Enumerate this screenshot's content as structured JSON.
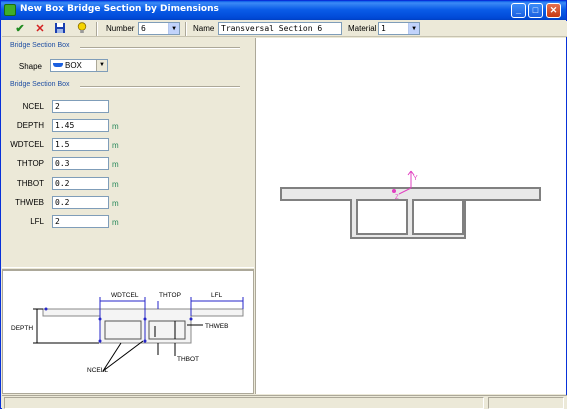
{
  "window": {
    "title": "New  Box Bridge Section by Dimensions"
  },
  "toolbar": {
    "number_label": "Number",
    "number_value": "6",
    "name_label": "Name",
    "name_value": "Transversal Section 6",
    "material_label": "Material",
    "material_value": "1",
    "icons": [
      "check-icon",
      "cancel-icon",
      "save-icon",
      "help-bulb-icon"
    ]
  },
  "panel": {
    "group1_title": "Bridge Section Box",
    "shape_label": "Shape",
    "shape_value": "BOX",
    "group2_title": "Bridge Section Box",
    "fields": [
      {
        "label": "NCEL",
        "value": "2",
        "unit": ""
      },
      {
        "label": "DEPTH",
        "value": "1.45",
        "unit": "m"
      },
      {
        "label": "WDTCEL",
        "value": "1.5",
        "unit": "m"
      },
      {
        "label": "THTOP",
        "value": "0.3",
        "unit": "m"
      },
      {
        "label": "THBOT",
        "value": "0.2",
        "unit": "m"
      },
      {
        "label": "THWEB",
        "value": "0.2",
        "unit": "m"
      },
      {
        "label": "LFL",
        "value": "2",
        "unit": "m"
      }
    ]
  },
  "diagram": {
    "labels": {
      "wdtcel": "WDTCEL",
      "thtop": "THTOP",
      "lfl": "LFL",
      "depth": "DEPTH",
      "thweb": "THWEB",
      "thbot": "THBOT",
      "ncell": "NCELL"
    }
  },
  "canvas": {
    "axis_y": "Y",
    "axis_z": "Z"
  },
  "colors": {
    "accent": "#0a5ce8",
    "unit_text": "#2a8a5c",
    "axis": "#e040c0",
    "diagram_blue": "#2626c8"
  }
}
